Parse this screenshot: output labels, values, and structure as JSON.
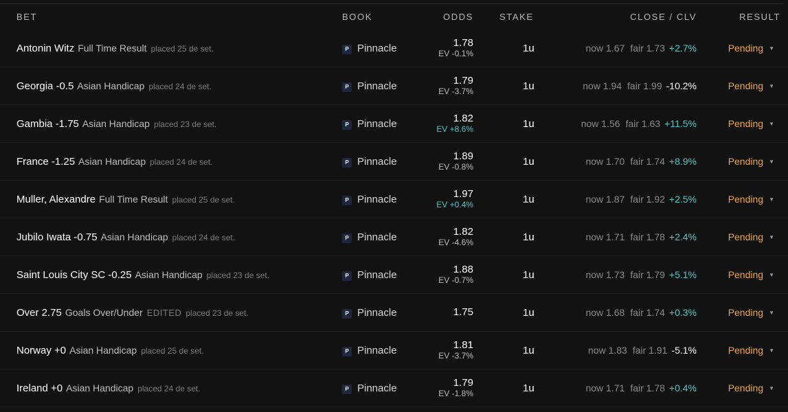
{
  "header": {
    "bet": "BET",
    "book": "BOOK",
    "odds": "ODDS",
    "stake": "STAKE",
    "close_clv": "CLOSE / CLV",
    "result": "RESULT"
  },
  "colors": {
    "background": "#121212",
    "positive": "#4fc6c8",
    "pending": "#f0a445"
  },
  "book_logo_icon": "pinnacle-logo-icon",
  "rows": [
    {
      "selection": "Antonin Witz",
      "market": "Full Time Result",
      "edited": "",
      "placed": "placed 25 de set.",
      "book": "Pinnacle",
      "odds": "1.78",
      "ev": "EV -0.1%",
      "ev_positive": false,
      "stake": "1u",
      "now": "now 1.67",
      "fair": "fair 1.73",
      "clv": "+2.7%",
      "clv_positive": true,
      "result": "Pending"
    },
    {
      "selection": "Georgia -0.5",
      "market": "Asian Handicap",
      "edited": "",
      "placed": "placed 24 de set.",
      "book": "Pinnacle",
      "odds": "1.79",
      "ev": "EV -3.7%",
      "ev_positive": false,
      "stake": "1u",
      "now": "now 1.94",
      "fair": "fair 1.99",
      "clv": "-10.2%",
      "clv_positive": false,
      "result": "Pending"
    },
    {
      "selection": "Gambia -1.75",
      "market": "Asian Handicap",
      "edited": "",
      "placed": "placed 23 de set.",
      "book": "Pinnacle",
      "odds": "1.82",
      "ev": "EV +8.6%",
      "ev_positive": true,
      "stake": "1u",
      "now": "now 1.56",
      "fair": "fair 1.63",
      "clv": "+11.5%",
      "clv_positive": true,
      "result": "Pending"
    },
    {
      "selection": "France -1.25",
      "market": "Asian Handicap",
      "edited": "",
      "placed": "placed 24 de set.",
      "book": "Pinnacle",
      "odds": "1.89",
      "ev": "EV -0.8%",
      "ev_positive": false,
      "stake": "1u",
      "now": "now 1.70",
      "fair": "fair 1.74",
      "clv": "+8.9%",
      "clv_positive": true,
      "result": "Pending"
    },
    {
      "selection": "Muller, Alexandre",
      "market": "Full Time Result",
      "edited": "",
      "placed": "placed 25 de set.",
      "book": "Pinnacle",
      "odds": "1.97",
      "ev": "EV +0.4%",
      "ev_positive": true,
      "stake": "1u",
      "now": "now 1.87",
      "fair": "fair 1.92",
      "clv": "+2.5%",
      "clv_positive": true,
      "result": "Pending"
    },
    {
      "selection": "Jubilo Iwata -0.75",
      "market": "Asian Handicap",
      "edited": "",
      "placed": "placed 24 de set.",
      "book": "Pinnacle",
      "odds": "1.82",
      "ev": "EV -4.6%",
      "ev_positive": false,
      "stake": "1u",
      "now": "now 1.71",
      "fair": "fair 1.78",
      "clv": "+2.4%",
      "clv_positive": true,
      "result": "Pending"
    },
    {
      "selection": "Saint Louis City SC -0.25",
      "market": "Asian Handicap",
      "edited": "",
      "placed": "placed 23 de set.",
      "book": "Pinnacle",
      "odds": "1.88",
      "ev": "EV -0.7%",
      "ev_positive": false,
      "stake": "1u",
      "now": "now 1.73",
      "fair": "fair 1.79",
      "clv": "+5.1%",
      "clv_positive": true,
      "result": "Pending"
    },
    {
      "selection": "Over 2.75",
      "market": "Goals Over/Under",
      "edited": "EDITED",
      "placed": "placed 23 de set.",
      "book": "Pinnacle",
      "odds": "1.75",
      "ev": "",
      "ev_positive": false,
      "stake": "1u",
      "now": "now 1.68",
      "fair": "fair 1.74",
      "clv": "+0.3%",
      "clv_positive": true,
      "result": "Pending"
    },
    {
      "selection": "Norway +0",
      "market": "Asian Handicap",
      "edited": "",
      "placed": "placed 25 de set.",
      "book": "Pinnacle",
      "odds": "1.81",
      "ev": "EV -3.7%",
      "ev_positive": false,
      "stake": "1u",
      "now": "now 1.83",
      "fair": "fair 1.91",
      "clv": "-5.1%",
      "clv_positive": false,
      "result": "Pending"
    },
    {
      "selection": "Ireland +0",
      "market": "Asian Handicap",
      "edited": "",
      "placed": "placed 24 de set.",
      "book": "Pinnacle",
      "odds": "1.79",
      "ev": "EV -1.8%",
      "ev_positive": false,
      "stake": "1u",
      "now": "now 1.71",
      "fair": "fair 1.78",
      "clv": "+0.4%",
      "clv_positive": true,
      "result": "Pending"
    }
  ]
}
